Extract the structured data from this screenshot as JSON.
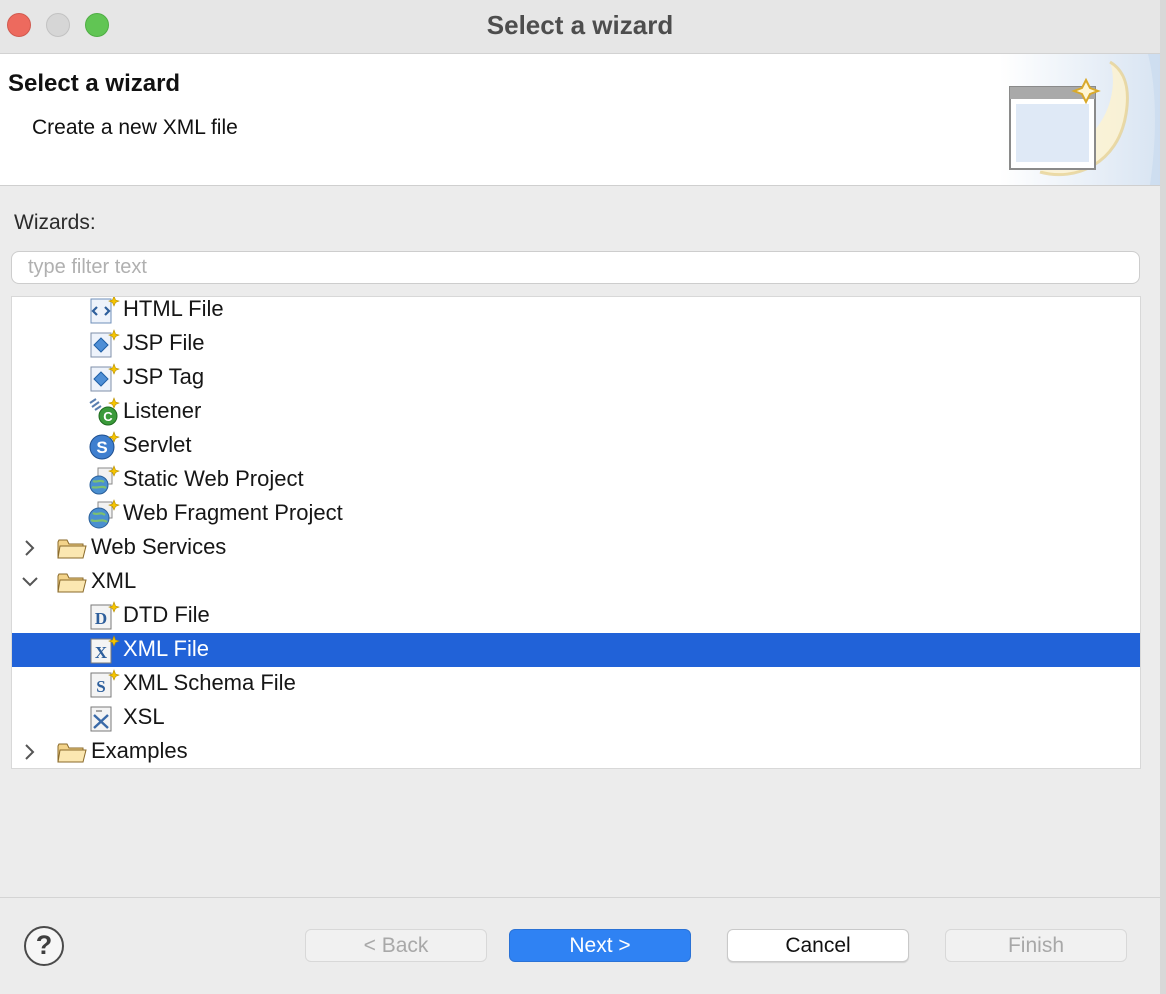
{
  "window": {
    "title": "Select a wizard"
  },
  "header": {
    "title": "Select a wizard",
    "description": "Create a new XML file"
  },
  "wizards_label": "Wizards:",
  "filter": {
    "placeholder": "type filter text",
    "value": ""
  },
  "tree": {
    "items": [
      {
        "label": "HTML File",
        "icon": "html-file-icon",
        "level": 2
      },
      {
        "label": "JSP File",
        "icon": "jsp-file-icon",
        "level": 2
      },
      {
        "label": "JSP Tag",
        "icon": "jsp-tag-icon",
        "level": 2
      },
      {
        "label": "Listener",
        "icon": "listener-icon",
        "level": 2
      },
      {
        "label": "Servlet",
        "icon": "servlet-icon",
        "level": 2
      },
      {
        "label": "Static Web Project",
        "icon": "static-web-project-icon",
        "level": 2
      },
      {
        "label": "Web Fragment Project",
        "icon": "web-fragment-project-icon",
        "level": 2
      },
      {
        "label": "Web Services",
        "icon": "folder-icon",
        "level": 1,
        "expanded": false
      },
      {
        "label": "XML",
        "icon": "folder-open-icon",
        "level": 1,
        "expanded": true
      },
      {
        "label": "DTD File",
        "icon": "dtd-file-icon",
        "level": 2
      },
      {
        "label": "XML File",
        "icon": "xml-file-icon",
        "level": 2,
        "selected": true
      },
      {
        "label": "XML Schema File",
        "icon": "xml-schema-file-icon",
        "level": 2
      },
      {
        "label": "XSL",
        "icon": "xsl-file-icon",
        "level": 2
      },
      {
        "label": "Examples",
        "icon": "folder-icon",
        "level": 1,
        "expanded": false
      }
    ]
  },
  "buttons": {
    "back": "< Back",
    "next": "Next >",
    "cancel": "Cancel",
    "finish": "Finish"
  },
  "colors": {
    "selection": "#2162d8",
    "primary_button": "#2f82f3"
  }
}
